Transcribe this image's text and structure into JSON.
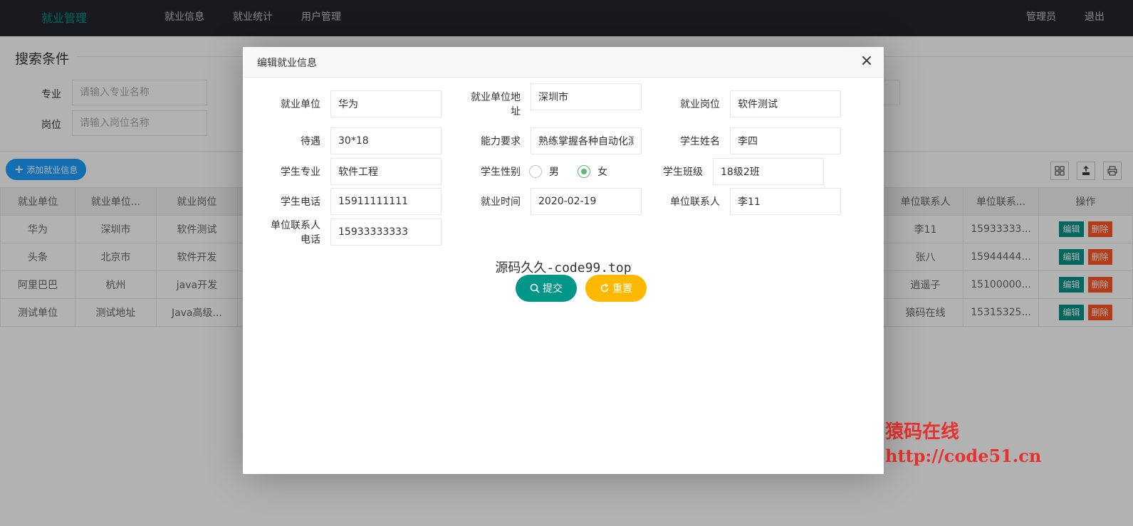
{
  "nav": {
    "brand": "就业管理",
    "items": [
      "就业信息",
      "就业统计",
      "用户管理"
    ],
    "user": "管理员",
    "logout": "退出"
  },
  "search": {
    "title": "搜索条件",
    "major_label": "专业",
    "major_placeholder": "请输入专业名称",
    "position_label": "岗位",
    "position_placeholder": "请输入岗位名称"
  },
  "toolbar": {
    "add_label": "添加就业信息",
    "icons": [
      "columns-icon",
      "export-icon",
      "print-icon"
    ]
  },
  "table": {
    "headers": {
      "unit": "就业单位",
      "address": "就业单位...",
      "post": "就业岗位",
      "contact": "单位联系人",
      "phone": "单位联系...",
      "actions": "操作"
    },
    "rows": [
      {
        "unit": "华为",
        "address": "深圳市",
        "post": "软件测试",
        "contact": "李11",
        "phone": "15933333..."
      },
      {
        "unit": "头条",
        "address": "北京市",
        "post": "软件开发",
        "contact": "张八",
        "phone": "15944444..."
      },
      {
        "unit": "阿里巴巴",
        "address": "杭州",
        "post": "java开发",
        "contact": "逍遥子",
        "phone": "15100000..."
      },
      {
        "unit": "测试单位",
        "address": "测试地址",
        "post": "Java高级...",
        "contact": "猿码在线",
        "phone": "15315325..."
      }
    ],
    "edit_label": "编辑",
    "delete_label": "删除"
  },
  "modal": {
    "title": "编辑就业信息",
    "close_icon": "close-icon",
    "fields": {
      "unit_label": "就业单位",
      "unit_value": "华为",
      "address_label_1": "就业单位地",
      "address_label_2": "址",
      "address_value": "深圳市",
      "post_label": "就业岗位",
      "post_value": "软件测试",
      "salary_label": "待遇",
      "salary_value": "30*18",
      "ability_label": "能力要求",
      "ability_value": "熟练掌握各种自动化测试",
      "student_name_label": "学生姓名",
      "student_name_value": "李四",
      "major_label": "学生专业",
      "major_value": "软件工程",
      "gender_label": "学生性别",
      "gender_male": "男",
      "gender_female": "女",
      "gender_selected": "女",
      "class_label": "学生班级",
      "class_value": "18级2班",
      "phone_label": "学生电话",
      "phone_value": "15911111111",
      "time_label": "就业时间",
      "time_value": "2020-02-19",
      "contact_label": "单位联系人",
      "contact_value": "李11",
      "contact_phone_label_1": "单位联系人",
      "contact_phone_label_2": "电话",
      "contact_phone_value": "15933333333"
    },
    "watermark": "源码久久-code99.top",
    "submit_label": "提交",
    "reset_label": "重置"
  },
  "watermark": {
    "line1": "猿码在线",
    "line2": "http://code51.cn"
  },
  "colors": {
    "topbar": "#23262e",
    "brand": "#009688",
    "add_button": "#1e9fff",
    "edit": "#009688",
    "delete": "#ff5722",
    "reset": "#ffb800",
    "watermark": "#e6322d"
  }
}
